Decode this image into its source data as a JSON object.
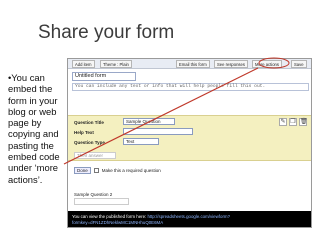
{
  "slide": {
    "title": "Share your form",
    "bullet": "•You can embed the form in your blog or web page by copying and pasting the embed code under ‘more actions’."
  },
  "toolbar": {
    "add_item": "Add item",
    "theme": "Theme : Plain",
    "email_form": "Email this form",
    "see_responses": "See responses",
    "more_actions": "More actions",
    "save": "Save"
  },
  "form": {
    "title": "Untitled form",
    "description": "You can include any text or info that will help people fill this out."
  },
  "question": {
    "title_label": "Question Title",
    "title_value": "Sample Question",
    "help_label": "Help Text",
    "type_label": "Question Type",
    "type_value": "Text",
    "answer_placeholder": "Their answer",
    "done_label": "Done",
    "required_label": "Make this a required question"
  },
  "question2": {
    "title": "Sample Question 2"
  },
  "footer": {
    "text": "You can view the published form here:",
    "url": "http://spreadsheets.google.com/viewform?formkey=dFN1ZDhNeklwMC1MNHhuQ0E6MA"
  },
  "colors": {
    "highlight": "#f4f0c0",
    "annotation": "#c0392b",
    "footer_bg": "#000000"
  }
}
